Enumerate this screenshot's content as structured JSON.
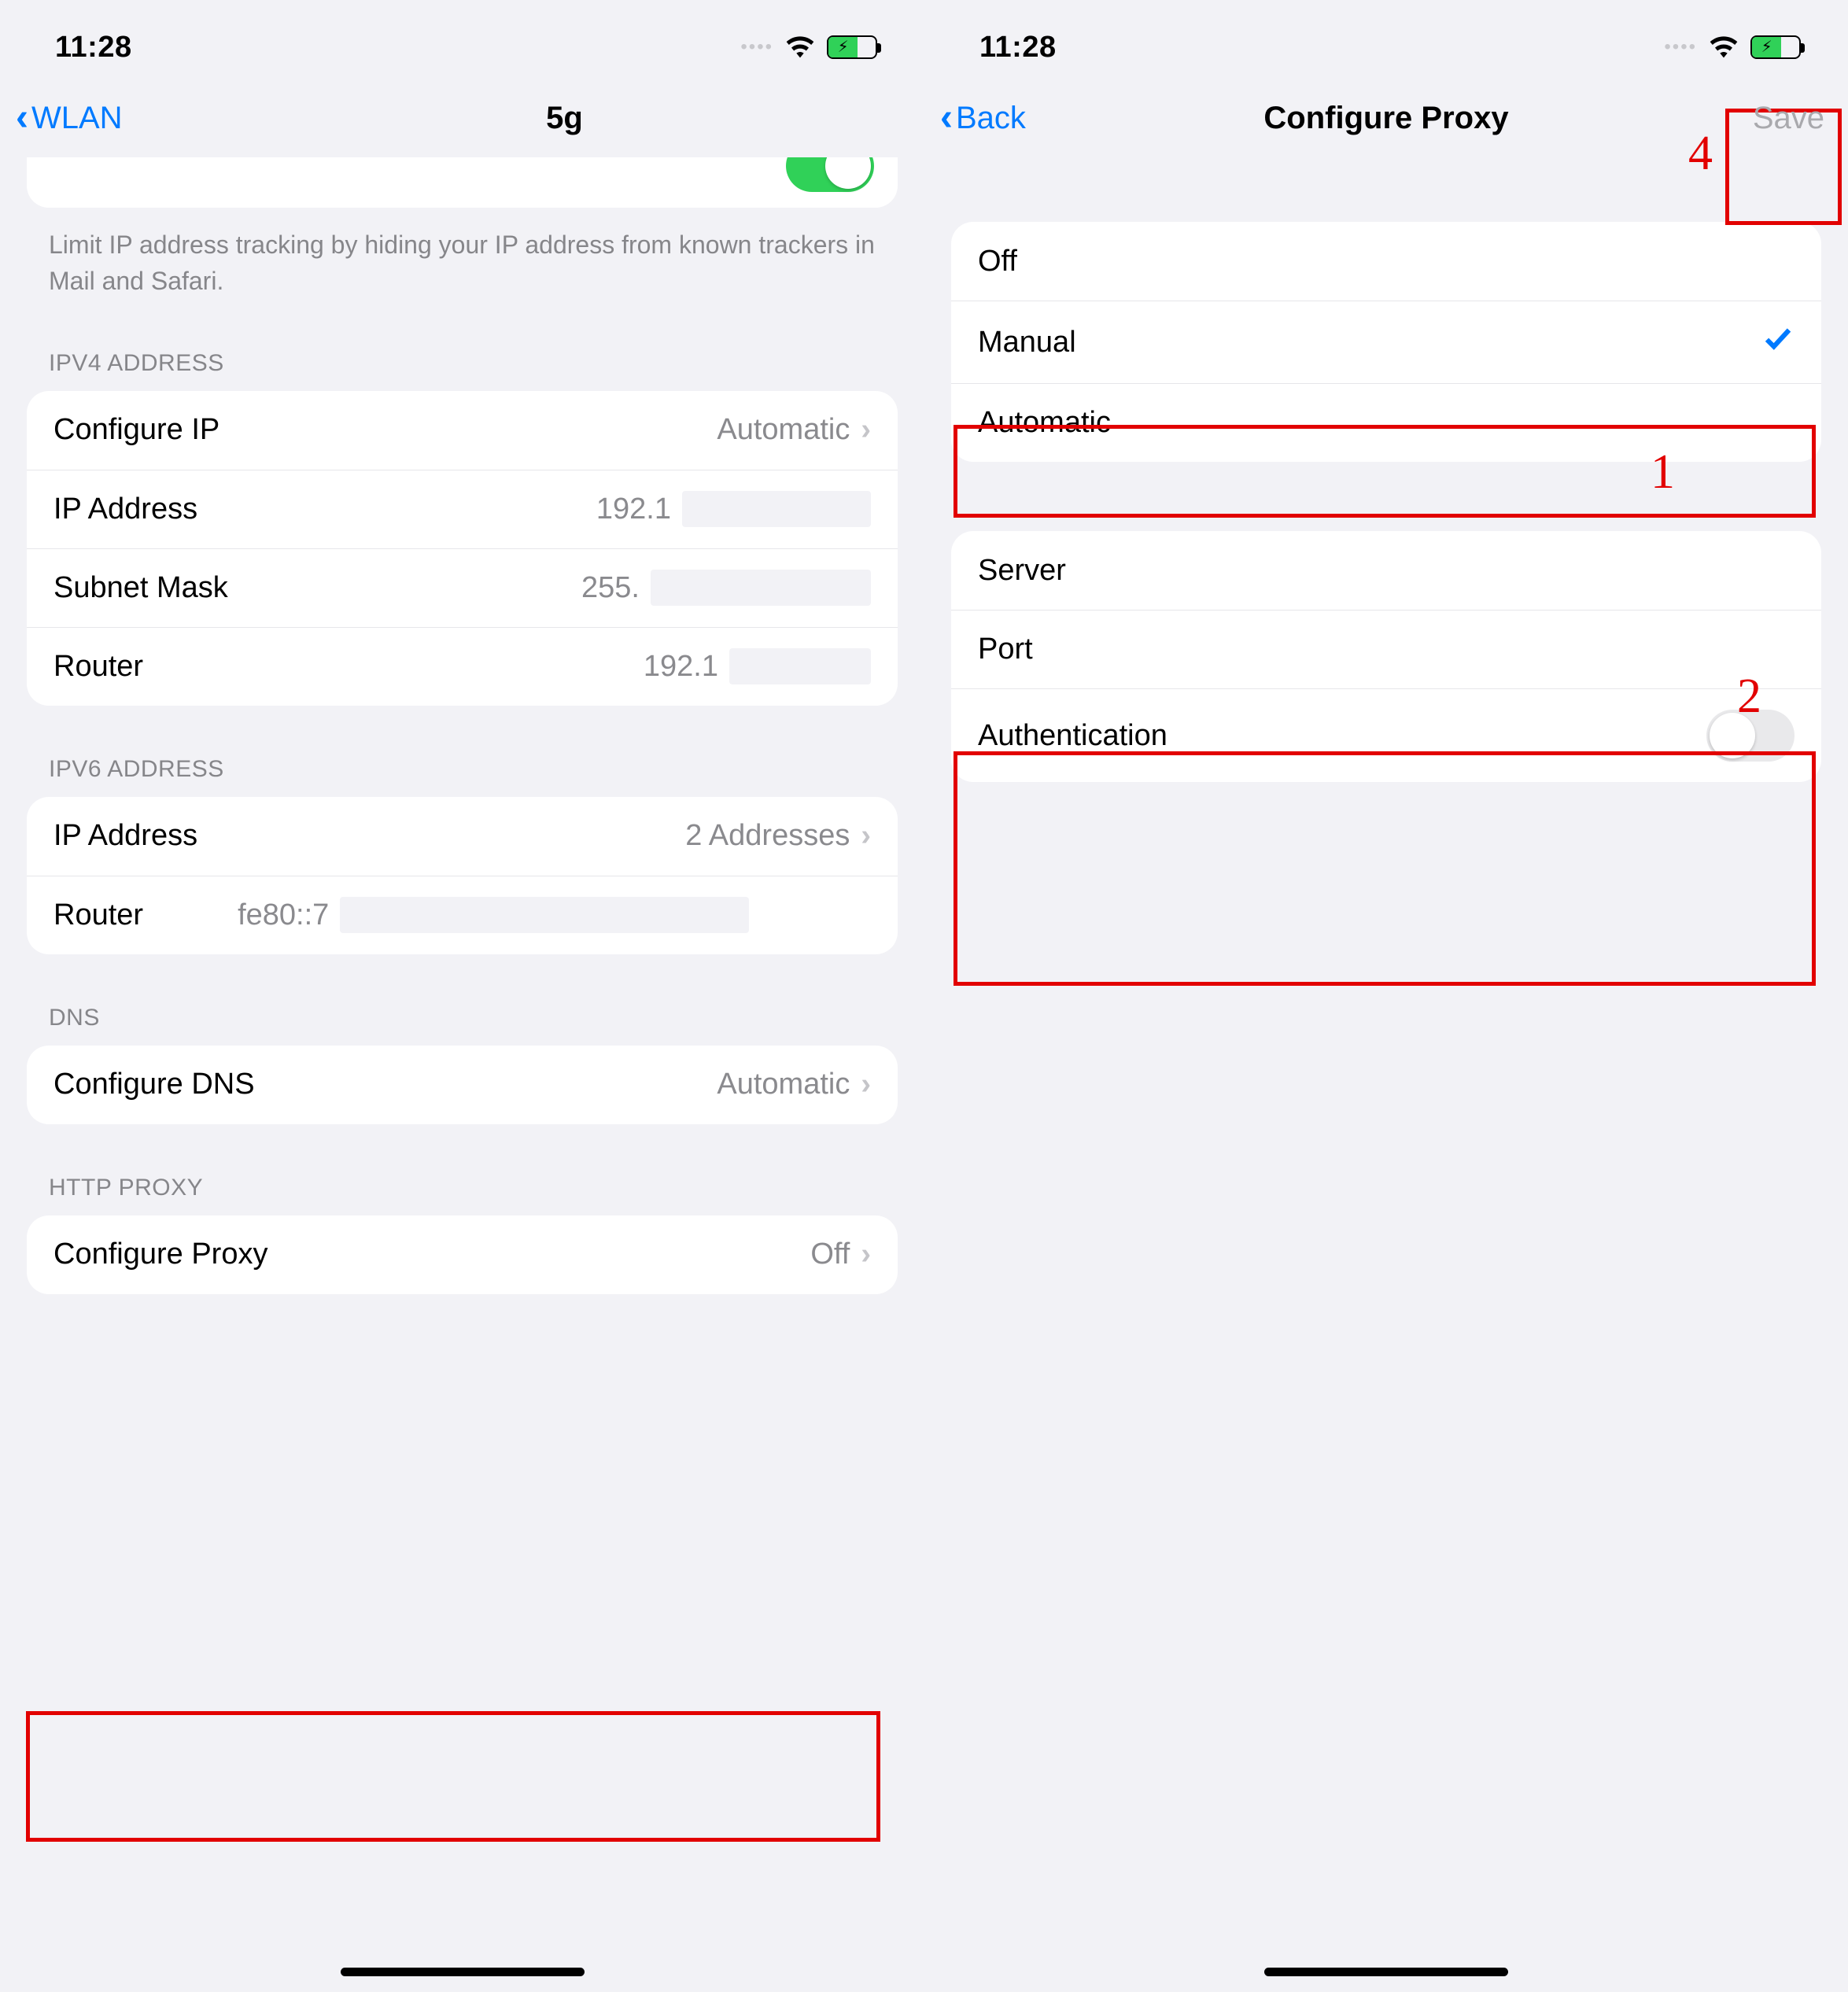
{
  "status": {
    "time": "11:28"
  },
  "left": {
    "nav_back": "WLAN",
    "title_suffix": "5g",
    "desc": "Limit IP address tracking by hiding your IP address from known trackers in Mail and Safari.",
    "section_ipv4": "IPV4 ADDRESS",
    "ipv4": {
      "configure_label": "Configure IP",
      "configure_value": "Automatic",
      "ip_label": "IP Address",
      "ip_value_visible": "192.1",
      "mask_label": "Subnet Mask",
      "mask_value_visible": "255.",
      "router_label": "Router",
      "router_value_visible": "192.1"
    },
    "section_ipv6": "IPV6 ADDRESS",
    "ipv6": {
      "ip_label": "IP Address",
      "ip_value": "2 Addresses",
      "router_label": "Router",
      "router_value_visible": "fe80::7"
    },
    "section_dns": "DNS",
    "dns": {
      "label": "Configure DNS",
      "value": "Automatic"
    },
    "section_proxy": "HTTP PROXY",
    "proxy": {
      "label": "Configure Proxy",
      "value": "Off"
    }
  },
  "right": {
    "nav_back": "Back",
    "title": "Configure Proxy",
    "save": "Save",
    "options": {
      "off": "Off",
      "manual": "Manual",
      "automatic": "Automatic"
    },
    "fields": {
      "server": "Server",
      "port": "Port",
      "auth": "Authentication"
    },
    "annotations": {
      "n1": "1",
      "n2": "2",
      "n4": "4"
    }
  }
}
